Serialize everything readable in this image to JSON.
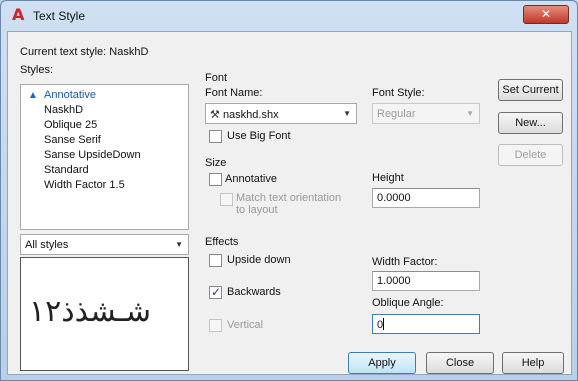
{
  "window": {
    "title": "Text Style",
    "close_glyph": "✕"
  },
  "current_style": {
    "label": "Current text style:",
    "value": "NaskhD"
  },
  "styles": {
    "label": "Styles:",
    "items": [
      "Annotative",
      "NaskhD",
      "Oblique 25",
      "Sanse Serif",
      "Sanse UpsideDown",
      "Standard",
      "Width Factor 1.5"
    ],
    "filter": "All styles"
  },
  "preview": {
    "text": "شـشذذ١٢"
  },
  "font": {
    "group_label": "Font",
    "name_label": "Font Name:",
    "name_value": "naskhd.shx",
    "style_label": "Font Style:",
    "style_value": "Regular",
    "use_big_font_label": "Use Big Font",
    "use_big_font_checked": false
  },
  "size": {
    "group_label": "Size",
    "annotative_label": "Annotative",
    "annotative_checked": false,
    "match_label_1": "Match text orientation",
    "match_label_2": "to layout",
    "height_label": "Height",
    "height_value": "0.0000"
  },
  "effects": {
    "group_label": "Effects",
    "upside_down_label": "Upside down",
    "upside_down_checked": false,
    "backwards_label": "Backwards",
    "backwards_checked": true,
    "vertical_label": "Vertical",
    "vertical_checked": false,
    "width_factor_label": "Width Factor:",
    "width_factor_value": "1.0000",
    "oblique_label": "Oblique Angle:",
    "oblique_value": "0"
  },
  "buttons": {
    "set_current": "Set Current",
    "new": "New...",
    "delete": "Delete",
    "apply": "Apply",
    "close": "Close",
    "help": "Help"
  },
  "colors": {
    "accent": "#1a56a8",
    "title_bar": "#bcd2ea"
  }
}
